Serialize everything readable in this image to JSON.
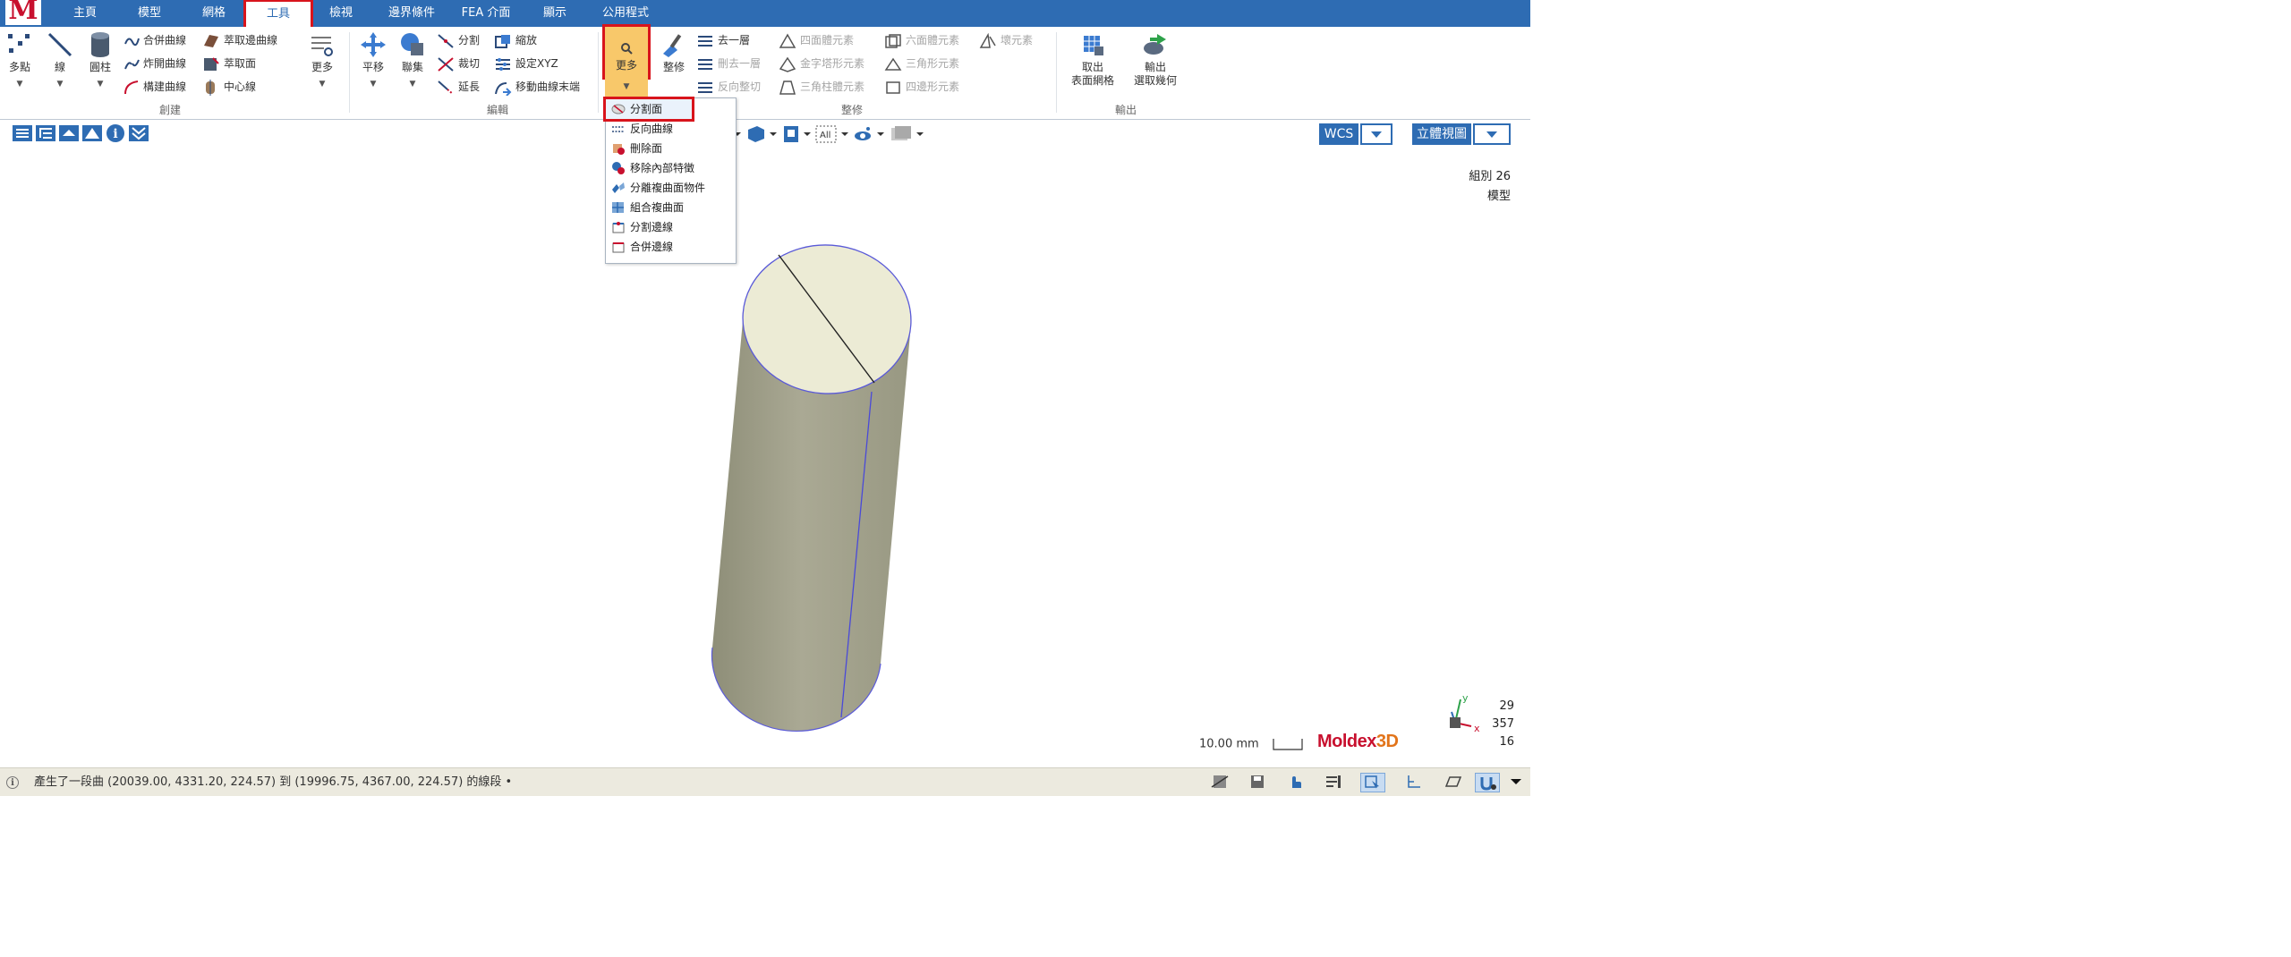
{
  "app": {
    "logo_letter": "M"
  },
  "tabs": [
    {
      "label": "主頁"
    },
    {
      "label": "模型"
    },
    {
      "label": "網格"
    },
    {
      "label": "工具",
      "active": true
    },
    {
      "label": "檢視"
    },
    {
      "label": "邊界條件"
    },
    {
      "label": "FEA 介面"
    },
    {
      "label": "顯示"
    },
    {
      "label": "公用程式"
    }
  ],
  "ribbon": {
    "create": {
      "label": "創建",
      "multipoint": "多點",
      "line": "線",
      "cylinder": "圓柱",
      "combine_curve": "合併曲線",
      "explode_curve": "炸開曲線",
      "construct_curve": "構建曲線",
      "extract_edge_curve": "萃取邊曲線",
      "extract_surface": "萃取面",
      "centerline": "中心線",
      "more": "更多"
    },
    "edit": {
      "label": "編輯",
      "translate": "平移",
      "union": "聯集",
      "split": "分割",
      "trim": "裁切",
      "extend": "延長",
      "scale": "縮放",
      "set_xyz": "設定XYZ",
      "move_curve_end": "移動曲線末端"
    },
    "repair": {
      "label": "整修",
      "more": "更多",
      "repair": "整修",
      "dedupe": "去一層",
      "remove_layer": "刪去一層",
      "reverse_repair": "反向整切",
      "tetra": "四面體元素",
      "pyramid": "金字塔形元素",
      "prism": "三角柱體元素",
      "hexa": "六面體元素",
      "tri": "三角形元素",
      "quad": "四邊形元素",
      "bad_elem": "壞元素"
    },
    "output": {
      "label": "輸出",
      "extract_surface_mesh": "取出\n表面網格",
      "export_selected_geometry": "輸出\n選取幾何"
    }
  },
  "dropdown": {
    "items": [
      {
        "label": "分割面",
        "highlighted": true
      },
      {
        "label": "反向曲線"
      },
      {
        "label": "刪除面"
      },
      {
        "label": "移除內部特徵"
      },
      {
        "label": "分離複曲面物件"
      },
      {
        "label": "組合複曲面"
      },
      {
        "label": "分割邊線"
      },
      {
        "label": "合併邊線"
      }
    ]
  },
  "viewbar": {
    "wcs": "WCS",
    "view": "立體視圖",
    "all_label": "All"
  },
  "viewport": {
    "group_label": "組別 26",
    "model_label": "模型",
    "scale_text": "10.00 mm",
    "brand_main": "Moldex",
    "brand_suffix": "3D",
    "coords": [
      "29",
      "357",
      "16"
    ],
    "axis_y": "y",
    "axis_x": "x"
  },
  "status": {
    "message": "產生了一段曲 (20039.00, 4331.20, 224.57) 到 (19996.75, 4367.00, 224.57) 的線段 •"
  },
  "colors": {
    "tabbar": "#2e6cb3",
    "highlight": "#d8141c",
    "more_btn": "#f8c86a",
    "cylinder_side": "#a3a38c",
    "cylinder_top": "#ecebd5",
    "brand": "#c8102e"
  }
}
